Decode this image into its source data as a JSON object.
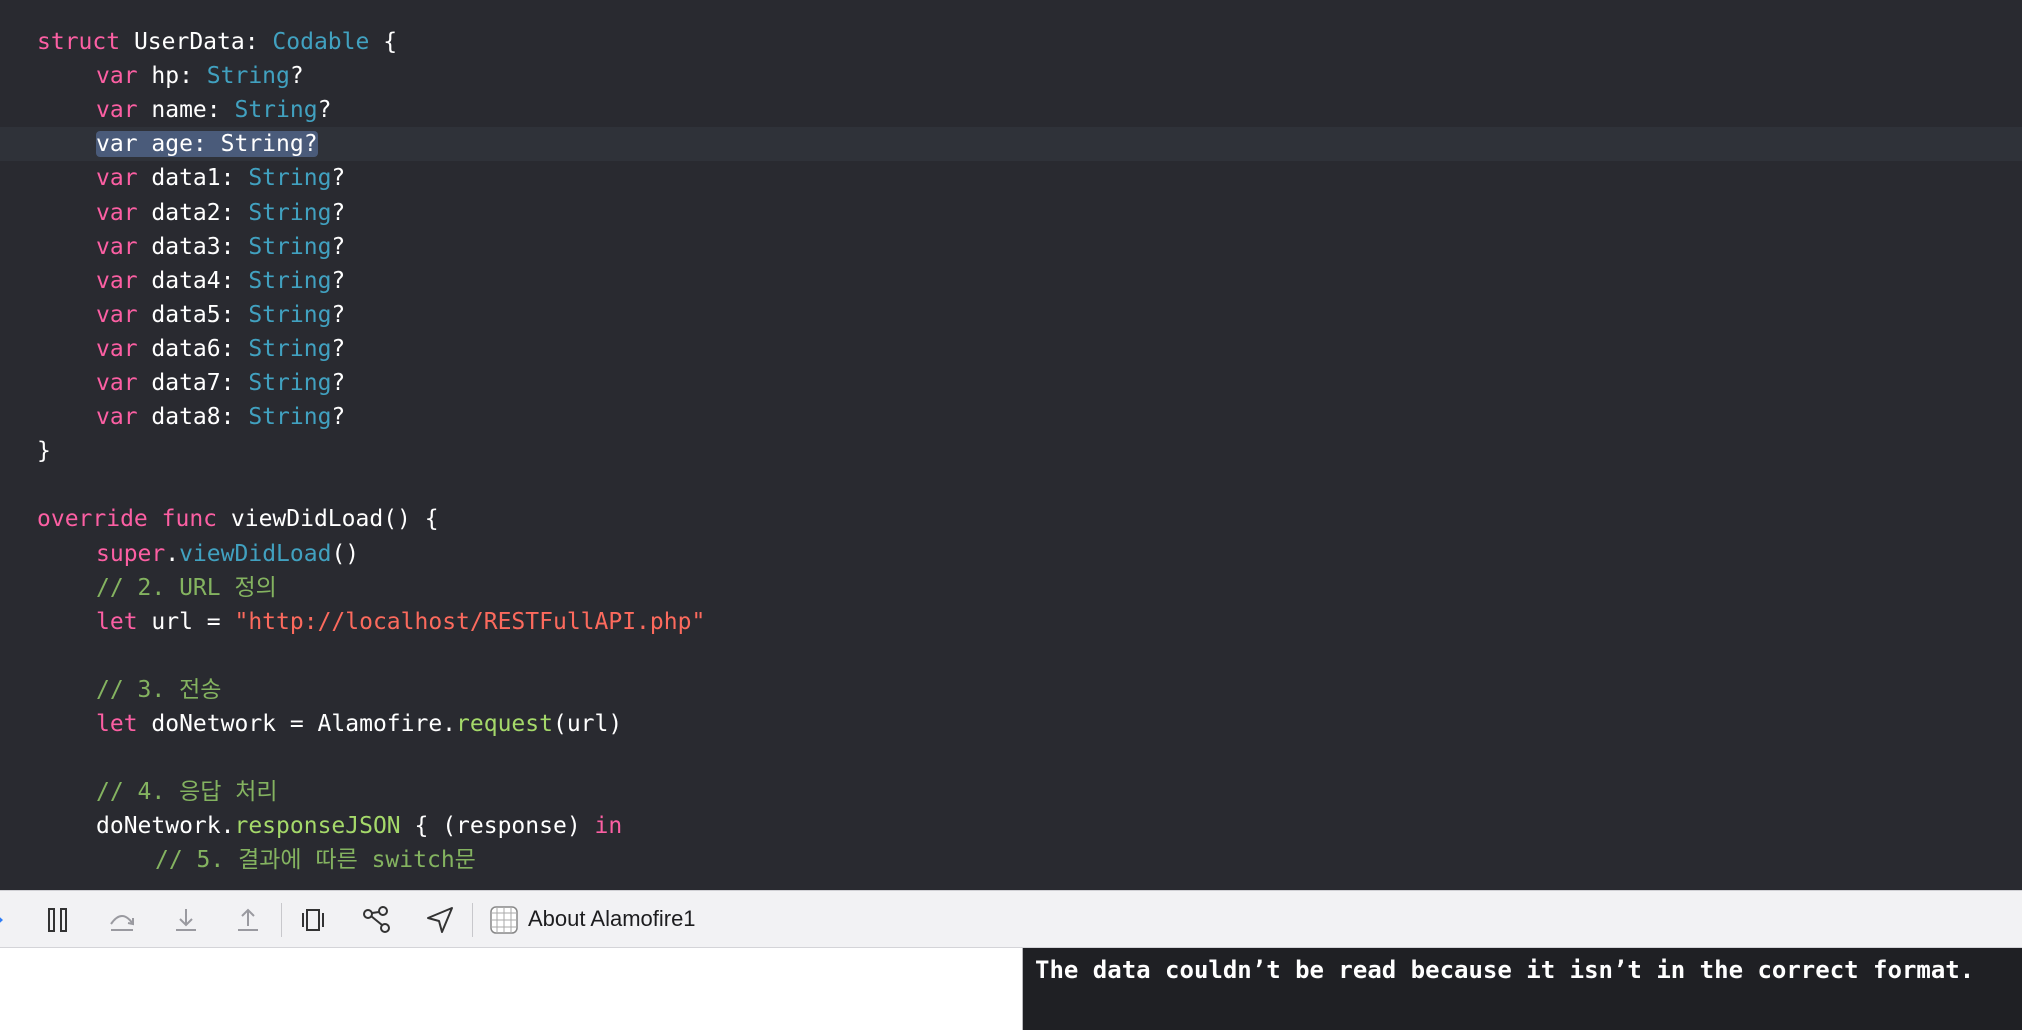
{
  "editor": {
    "lines": [
      {
        "indent": 0,
        "current": false,
        "tokens": [
          [
            "keyword",
            "struct "
          ],
          [
            "plain",
            "UserData: "
          ],
          [
            "type2",
            "Codable"
          ],
          [
            "plain",
            " {"
          ]
        ]
      },
      {
        "indent": 1,
        "current": false,
        "tokens": [
          [
            "keyword",
            "var "
          ],
          [
            "plain",
            "hp: "
          ],
          [
            "type2",
            "String"
          ],
          [
            "plain",
            "?"
          ]
        ]
      },
      {
        "indent": 1,
        "current": false,
        "tokens": [
          [
            "keyword",
            "var "
          ],
          [
            "plain",
            "name: "
          ],
          [
            "type2",
            "String"
          ],
          [
            "plain",
            "?"
          ]
        ]
      },
      {
        "indent": 1,
        "current": true,
        "tokens": [
          [
            "sel",
            "var age: String?"
          ]
        ]
      },
      {
        "indent": 1,
        "current": false,
        "tokens": [
          [
            "keyword",
            "var "
          ],
          [
            "plain",
            "data1: "
          ],
          [
            "type2",
            "String"
          ],
          [
            "plain",
            "?"
          ]
        ]
      },
      {
        "indent": 1,
        "current": false,
        "tokens": [
          [
            "keyword",
            "var "
          ],
          [
            "plain",
            "data2: "
          ],
          [
            "type2",
            "String"
          ],
          [
            "plain",
            "?"
          ]
        ]
      },
      {
        "indent": 1,
        "current": false,
        "tokens": [
          [
            "keyword",
            "var "
          ],
          [
            "plain",
            "data3: "
          ],
          [
            "type2",
            "String"
          ],
          [
            "plain",
            "?"
          ]
        ]
      },
      {
        "indent": 1,
        "current": false,
        "tokens": [
          [
            "keyword",
            "var "
          ],
          [
            "plain",
            "data4: "
          ],
          [
            "type2",
            "String"
          ],
          [
            "plain",
            "?"
          ]
        ]
      },
      {
        "indent": 1,
        "current": false,
        "tokens": [
          [
            "keyword",
            "var "
          ],
          [
            "plain",
            "data5: "
          ],
          [
            "type2",
            "String"
          ],
          [
            "plain",
            "?"
          ]
        ]
      },
      {
        "indent": 1,
        "current": false,
        "tokens": [
          [
            "keyword",
            "var "
          ],
          [
            "plain",
            "data6: "
          ],
          [
            "type2",
            "String"
          ],
          [
            "plain",
            "?"
          ]
        ]
      },
      {
        "indent": 1,
        "current": false,
        "tokens": [
          [
            "keyword",
            "var "
          ],
          [
            "plain",
            "data7: "
          ],
          [
            "type2",
            "String"
          ],
          [
            "plain",
            "?"
          ]
        ]
      },
      {
        "indent": 1,
        "current": false,
        "tokens": [
          [
            "keyword",
            "var "
          ],
          [
            "plain",
            "data8: "
          ],
          [
            "type2",
            "String"
          ],
          [
            "plain",
            "?"
          ]
        ]
      },
      {
        "indent": 0,
        "current": false,
        "tokens": [
          [
            "plain",
            "}"
          ]
        ]
      },
      {
        "indent": 0,
        "current": false,
        "tokens": []
      },
      {
        "indent": 0,
        "current": false,
        "tokens": [
          [
            "keyword",
            "override "
          ],
          [
            "keyword",
            "func "
          ],
          [
            "plain",
            "viewDidLoad() {"
          ]
        ]
      },
      {
        "indent": 1,
        "current": false,
        "tokens": [
          [
            "keyword",
            "super"
          ],
          [
            "plain",
            "."
          ],
          [
            "type2",
            "viewDidLoad"
          ],
          [
            "plain",
            "()"
          ]
        ]
      },
      {
        "indent": 1,
        "current": false,
        "tokens": [
          [
            "comment-g",
            "// 2. URL 정의"
          ]
        ]
      },
      {
        "indent": 1,
        "current": false,
        "tokens": [
          [
            "keyword",
            "let "
          ],
          [
            "plain",
            "url = "
          ],
          [
            "string",
            "\"http://localhost/RESTFullAPI.php\""
          ]
        ]
      },
      {
        "indent": 0,
        "current": false,
        "tokens": []
      },
      {
        "indent": 1,
        "current": false,
        "tokens": [
          [
            "comment-g",
            "// 3. 전송"
          ]
        ]
      },
      {
        "indent": 1,
        "current": false,
        "tokens": [
          [
            "keyword",
            "let "
          ],
          [
            "plain",
            "doNetwork = Alamofire."
          ],
          [
            "method",
            "request"
          ],
          [
            "plain",
            "(url)"
          ]
        ]
      },
      {
        "indent": 0,
        "current": false,
        "tokens": []
      },
      {
        "indent": 1,
        "current": false,
        "tokens": [
          [
            "comment-g",
            "// 4. 응답 처리"
          ]
        ]
      },
      {
        "indent": 1,
        "current": false,
        "tokens": [
          [
            "plain",
            "doNetwork."
          ],
          [
            "method",
            "responseJSON"
          ],
          [
            "plain",
            " { (response) "
          ],
          [
            "keyword",
            "in"
          ]
        ]
      },
      {
        "indent": 2,
        "current": false,
        "tokens": [
          [
            "comment-g",
            "// 5. 결과에 따른 switch문"
          ]
        ]
      }
    ]
  },
  "debug_bar": {
    "buttons": [
      {
        "name": "continue-indicator-icon"
      },
      {
        "name": "pause-icon"
      },
      {
        "name": "step-over-icon"
      },
      {
        "name": "step-into-icon"
      },
      {
        "name": "step-out-icon"
      },
      {
        "name": "view-hierarchy-icon"
      },
      {
        "name": "memory-graph-icon"
      },
      {
        "name": "location-icon"
      },
      {
        "name": "app-icon"
      }
    ],
    "process_label": "About Alamofire1"
  },
  "console": {
    "text": "The data couldn’t be read because it isn’t in the correct format."
  },
  "colors": {
    "editor_bg": "#292a30",
    "keyword": "#fc5fa3",
    "type": "#41a1c0",
    "comment": "#84b360",
    "string": "#fc6a5d",
    "method": "#a5d96a"
  }
}
